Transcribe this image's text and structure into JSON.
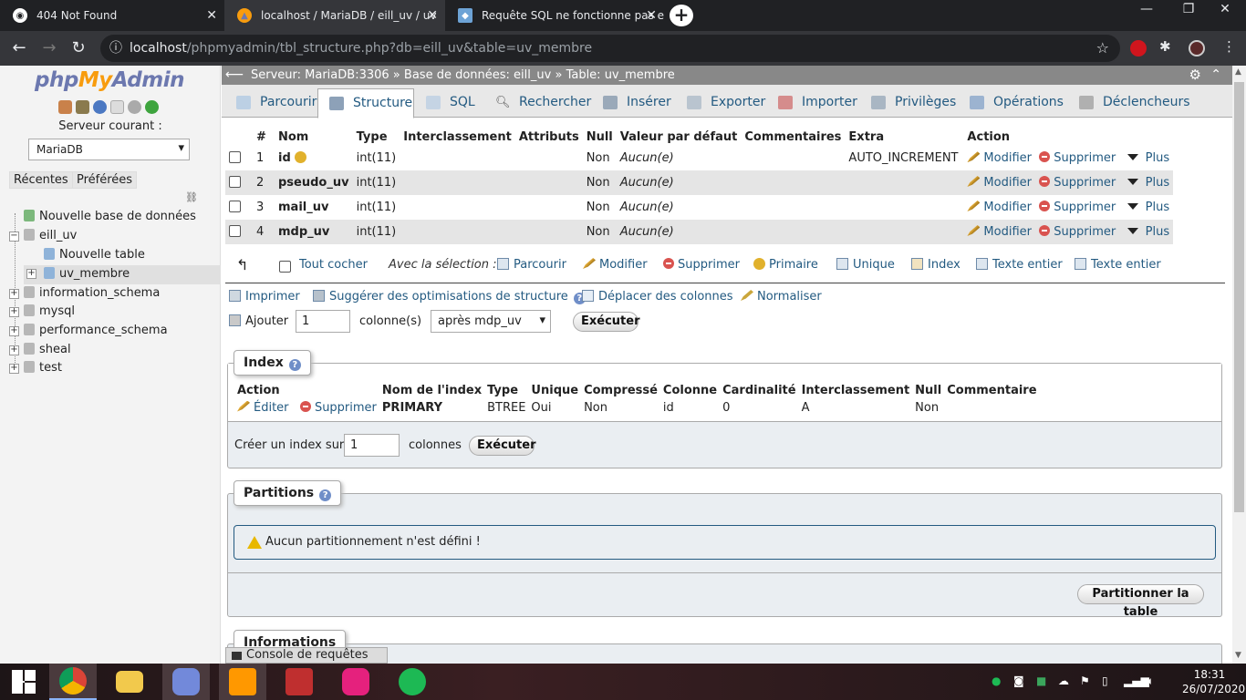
{
  "browser": {
    "tabs": [
      {
        "title": "404 Not Found",
        "active": false
      },
      {
        "title": "localhost / MariaDB / eill_uv / uv",
        "active": true
      },
      {
        "title": "Requête SQL ne fonctionne pas e",
        "active": false
      }
    ],
    "url_host": "localhost",
    "url_path": "/phpmyadmin/tbl_structure.php?db=eill_uv&table=uv_membre"
  },
  "sidebar": {
    "logo_php": "php",
    "logo_my": "My",
    "logo_admin": "Admin",
    "server_label": "Serveur courant :",
    "server_value": "MariaDB",
    "recent": "Récentes",
    "favorites": "Préférées",
    "tree": [
      {
        "label": "Nouvelle base de données",
        "level": 0
      },
      {
        "label": "eill_uv",
        "level": 0
      },
      {
        "label": "Nouvelle table",
        "level": 1
      },
      {
        "label": "uv_membre",
        "level": 1
      },
      {
        "label": "information_schema",
        "level": 0
      },
      {
        "label": "mysql",
        "level": 0
      },
      {
        "label": "performance_schema",
        "level": 0
      },
      {
        "label": "sheal",
        "level": 0
      },
      {
        "label": "test",
        "level": 0
      }
    ]
  },
  "breadcrumb": {
    "server": "Serveur: MariaDB:3306",
    "sep1": "»",
    "database": "Base de données: eill_uv",
    "sep2": "»",
    "table": "Table: uv_membre"
  },
  "tabs": [
    "Parcourir",
    "Structure",
    "SQL",
    "Rechercher",
    "Insérer",
    "Exporter",
    "Importer",
    "Privilèges",
    "Opérations",
    "Déclencheurs"
  ],
  "structure": {
    "headers": [
      "#",
      "Nom",
      "Type",
      "Interclassement",
      "Attributs",
      "Null",
      "Valeur par défaut",
      "Commentaires",
      "Extra",
      "Action"
    ],
    "rows": [
      {
        "num": "1",
        "name": "id",
        "type": "int(11)",
        "null": "Non",
        "default": "Aucun(e)",
        "extra": "AUTO_INCREMENT"
      },
      {
        "num": "2",
        "name": "pseudo_uv",
        "type": "int(11)",
        "null": "Non",
        "default": "Aucun(e)",
        "extra": ""
      },
      {
        "num": "3",
        "name": "mail_uv",
        "type": "int(11)",
        "null": "Non",
        "default": "Aucun(e)",
        "extra": ""
      },
      {
        "num": "4",
        "name": "mdp_uv",
        "type": "int(11)",
        "null": "Non",
        "default": "Aucun(e)",
        "extra": ""
      }
    ],
    "actions": {
      "modify": "Modifier",
      "delete": "Supprimer",
      "more": "Plus"
    }
  },
  "selection": {
    "check_all": "Tout cocher",
    "with_selection": "Avec la sélection :",
    "items": [
      "Parcourir",
      "Modifier",
      "Supprimer",
      "Primaire",
      "Unique",
      "Index",
      "Texte entier",
      "Texte entier"
    ]
  },
  "tools": {
    "print": "Imprimer",
    "suggest": "Suggérer des optimisations de structure",
    "move": "Déplacer des colonnes",
    "normalize": "Normaliser",
    "add": "Ajouter",
    "add_count": "1",
    "columns": "colonne(s)",
    "position": "après mdp_uv",
    "execute": "Exécuter"
  },
  "index_section": {
    "legend": "Index",
    "headers": [
      "Action",
      "Nom de l'index",
      "Type",
      "Unique",
      "Compressé",
      "Colonne",
      "Cardinalité",
      "Interclassement",
      "Null",
      "Commentaire"
    ],
    "row": {
      "edit": "Éditer",
      "delete": "Supprimer",
      "name": "PRIMARY",
      "type": "BTREE",
      "unique": "Oui",
      "compressed": "Non",
      "column": "id",
      "cardinality": "0",
      "collation": "A",
      "null": "Non",
      "comment": ""
    },
    "create_label": "Créer un index sur",
    "create_count": "1",
    "columns": "colonnes",
    "execute": "Exécuter"
  },
  "partitions": {
    "legend": "Partitions",
    "notice": "Aucun partitionnement n'est défini !",
    "button": "Partitionner la table"
  },
  "informations": {
    "legend": "Informations"
  },
  "console": "Console de requêtes SQL",
  "clock": {
    "time": "18:31",
    "date": "26/07/2020"
  }
}
